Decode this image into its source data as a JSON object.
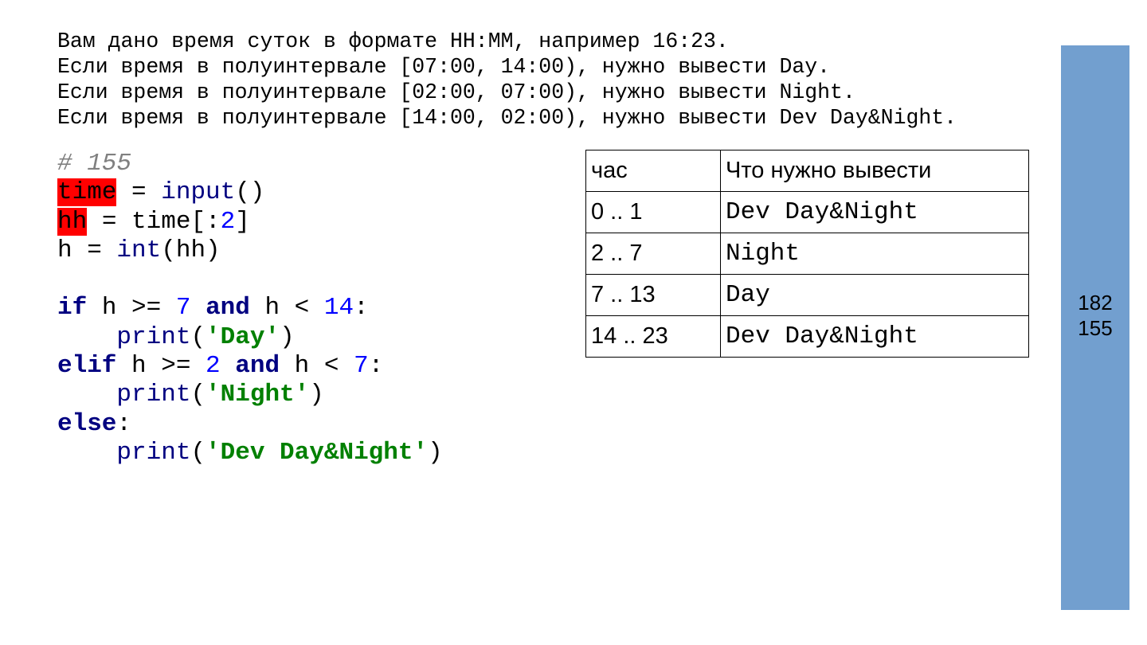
{
  "task_text": [
    "Вам дано время суток в формате HH:MM, например 16:23.",
    "Если время в полуинтервале [07:00, 14:00), нужно вывести Day.",
    "Если время в полуинтервале [02:00, 07:00), нужно вывести Night.",
    "Если время в полуинтервале [14:00, 02:00), нужно вывести Dev Day&Night."
  ],
  "code": {
    "comment": "# 155",
    "lines": [
      {
        "var": "time",
        "op": " = ",
        "fn": "input",
        "rest": "()"
      },
      {
        "var": "hh",
        "rest": " = time[:",
        "num": "2",
        "end": "]"
      },
      {
        "pre": "h = ",
        "fn": "int",
        "rest": "(hh)"
      }
    ],
    "if_line": {
      "kw": "if",
      "a": " h >= ",
      "n1": "7",
      "and": "and",
      "b": " h < ",
      "n2": "14",
      "end": ":"
    },
    "print_day": {
      "fn": "print",
      "str": "'Day'"
    },
    "elif_line": {
      "kw": "elif",
      "a": " h >= ",
      "n1": "2",
      "and": "and",
      "b": " h < ",
      "n2": "7",
      "end": ":"
    },
    "print_night": {
      "fn": "print",
      "str": "'Night'"
    },
    "else_line": {
      "kw": "else",
      "end": ":"
    },
    "print_both": {
      "fn": "print",
      "str": "'Dev Day&Night'"
    }
  },
  "table": {
    "headers": [
      "час",
      "Что нужно вывести"
    ],
    "rows": [
      [
        "0 .. 1",
        "Dev Day&Night"
      ],
      [
        "2 .. 7",
        "Night"
      ],
      [
        "7 .. 13",
        "Day"
      ],
      [
        "14 .. 23",
        "Dev Day&Night"
      ]
    ]
  },
  "sidebar": {
    "color": "#729fcf",
    "numbers": [
      "182",
      "155"
    ]
  },
  "colors": {
    "keyword": "#000080",
    "number": "#0000ff",
    "string": "#008000",
    "comment": "#808080",
    "highlight": "#ff0000"
  }
}
